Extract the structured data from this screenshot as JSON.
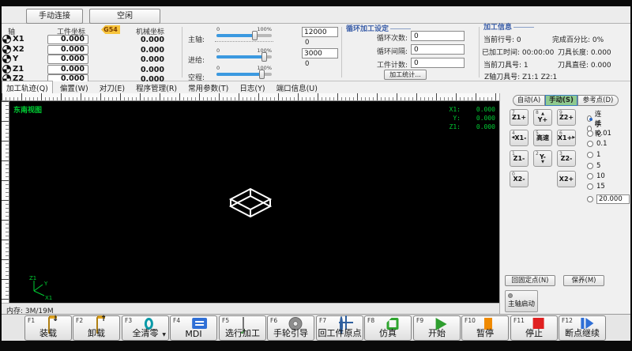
{
  "window": {
    "top_tabs": [
      {
        "label": "手动连接"
      },
      {
        "label": "空闲"
      }
    ]
  },
  "axis_panel": {
    "headers": {
      "axis": "轴",
      "work": "工件坐标",
      "g54": "G54",
      "machine": "机械坐标"
    },
    "rows": [
      {
        "name": "X1",
        "work": "0.000",
        "machine": "0.000"
      },
      {
        "name": "X2",
        "work": "0.000",
        "machine": "0.000"
      },
      {
        "name": "Y",
        "work": "0.000",
        "machine": "0.000"
      },
      {
        "name": "Z1",
        "work": "0.000",
        "machine": "0.000"
      },
      {
        "name": "Z2",
        "work": "0.000",
        "machine": "0.000"
      }
    ]
  },
  "overrides": {
    "items": [
      {
        "label": "主轴:",
        "min": "0",
        "max": "100%",
        "percent": 68
      },
      {
        "label": "进给:",
        "min": "0",
        "max": "100%",
        "percent": 85
      },
      {
        "label": "空程:",
        "min": "0",
        "max": "100%",
        "percent": 82
      }
    ],
    "spindle_value": "12000",
    "spindle_sub": "0",
    "feed_value": "3000",
    "feed_sub": "0"
  },
  "cycle_box": {
    "title": "循环加工设定",
    "fields": [
      {
        "label": "循环次数:",
        "value": "0"
      },
      {
        "label": "循环间隔:",
        "value": "0"
      },
      {
        "label": "工件计数:",
        "value": "0"
      }
    ],
    "stats_button": "加工统计..."
  },
  "info": {
    "title": "加工信息",
    "items": [
      {
        "text": "当前行号: 0"
      },
      {
        "text": "完成百分比: 0%"
      },
      {
        "text": "已加工时间: 00:00:00"
      },
      {
        "text": "刀具长度: 0.000"
      },
      {
        "text": "当前刀具号: 1"
      },
      {
        "text": "刀具直径: 0.000"
      },
      {
        "text": "Z轴刀具号: Z1:1  Z2:1"
      }
    ]
  },
  "menu": {
    "items": [
      {
        "label": "加工轨迹(Q)"
      },
      {
        "label": "偏置(W)"
      },
      {
        "label": "对刀(E)"
      },
      {
        "label": "程序管理(R)"
      },
      {
        "label": "常用参数(T)"
      },
      {
        "label": "日志(Y)"
      },
      {
        "label": "端口信息(U)"
      }
    ]
  },
  "viewport": {
    "view_label": "东南视图",
    "readout": [
      {
        "label": "X1:",
        "value": "0.000"
      },
      {
        "label": "Y:",
        "value": "0.000"
      },
      {
        "label": "Z1:",
        "value": "0.000"
      }
    ],
    "triad": {
      "up": "Z1",
      "mid": "Y",
      "down": "X1"
    },
    "status": "内存: 3M/19M"
  },
  "mode_tabs": [
    {
      "label": "自动(A)"
    },
    {
      "label": "手动(S)"
    },
    {
      "label": "参考点(D)"
    }
  ],
  "jog": {
    "buttons": [
      {
        "key": "7",
        "label": "Z1+"
      },
      {
        "key": "8",
        "label": "Y+",
        "arrow_up": "▲"
      },
      {
        "key": "9",
        "label": "Z2+"
      },
      {
        "key": "4",
        "label": "X1-",
        "arrow_left": "◀"
      },
      {
        "key": "5",
        "label": "高速"
      },
      {
        "key": "6",
        "label": "X1+",
        "arrow_right": "▶"
      },
      {
        "key": "1",
        "label": "Z1-"
      },
      {
        "key": "2",
        "label": "Y-",
        "arrow_down": "▼"
      },
      {
        "key": "3",
        "label": "Z2-"
      },
      {
        "key": "0",
        "label": "X2-"
      },
      {
        "key": ".",
        "label": "X2+"
      }
    ]
  },
  "step_options": [
    {
      "label": "连续",
      "selected": true
    },
    {
      "label": "手轮",
      "selected": false
    },
    {
      "label": "0.01",
      "selected": false
    },
    {
      "label": "0.1",
      "selected": false
    },
    {
      "label": "1",
      "selected": false
    },
    {
      "label": "5",
      "selected": false
    },
    {
      "label": "10",
      "selected": false
    },
    {
      "label": "15",
      "selected": false
    }
  ],
  "custom_step": "20.000",
  "side_buttons": {
    "fixed_point": "回固定点(N)",
    "maintain": "保养(M)",
    "spindle_start": "主轴启动"
  },
  "fkeys": [
    {
      "key": "F1",
      "label": "装载"
    },
    {
      "key": "F2",
      "label": "卸载"
    },
    {
      "key": "F3",
      "label": "全清零"
    },
    {
      "key": "F4",
      "label": "MDI"
    },
    {
      "key": "F5",
      "label": "选行加工"
    },
    {
      "key": "F6",
      "label": "手轮引导"
    },
    {
      "key": "F7",
      "label": "回工件原点"
    },
    {
      "key": "F8",
      "label": "仿真"
    },
    {
      "key": "F9",
      "label": "开始"
    },
    {
      "key": "F10",
      "label": "暂停"
    },
    {
      "key": "F11",
      "label": "停止"
    },
    {
      "key": "F12",
      "label": "断点继续"
    }
  ],
  "colors": {
    "active_tab_green": "#8fca8f",
    "g54_badge_yellow": "#f7c43c",
    "slider_blue": "#3b99e0",
    "canvas_text_green": "#00cc33",
    "start_green": "#2e9e2e",
    "pause_orange": "#f08a00",
    "stop_red": "#e02020",
    "resume_blue": "#2f6fd6"
  }
}
